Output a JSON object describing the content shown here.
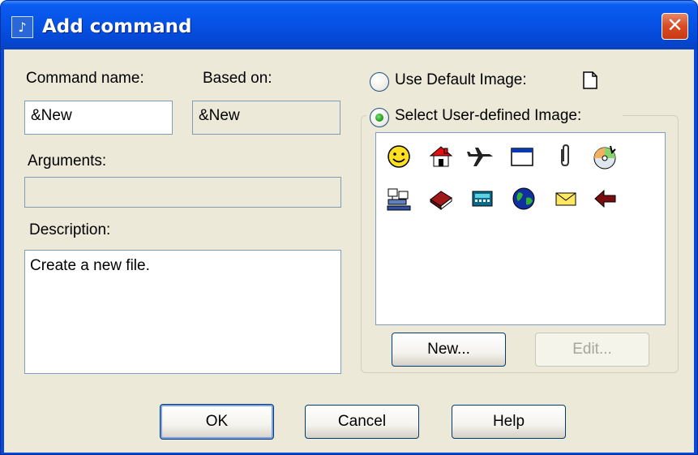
{
  "window": {
    "title": "Add command",
    "close_glyph": "✕"
  },
  "fields": {
    "command_name_label": "Command name:",
    "command_name_value": "&New",
    "based_on_label": "Based on:",
    "based_on_value": "&New",
    "arguments_label": "Arguments:",
    "arguments_value": "",
    "description_label": "Description:",
    "description_value": "Create a new file."
  },
  "image": {
    "use_default_label": "Use Default Image:",
    "use_default_selected": false,
    "user_defined_label": "Select User-defined Image:",
    "user_defined_selected": true,
    "icons": [
      [
        "smiley-icon",
        "house-icon",
        "airplane-icon",
        "window-icon",
        "paperclip-icon",
        "cd-icon"
      ],
      [
        "network-icon",
        "book-icon",
        "calculator-icon",
        "globe-icon",
        "envelope-icon",
        "back-arrow-icon"
      ]
    ]
  },
  "buttons": {
    "new_label": "New...",
    "edit_label": "Edit...",
    "ok_label": "OK",
    "cancel_label": "Cancel",
    "help_label": "Help"
  },
  "colors": {
    "title_bar": "#0653e6",
    "dialog_face": "#ece9d8",
    "close_button": "#d94a22",
    "field_border": "#7f9db9"
  }
}
